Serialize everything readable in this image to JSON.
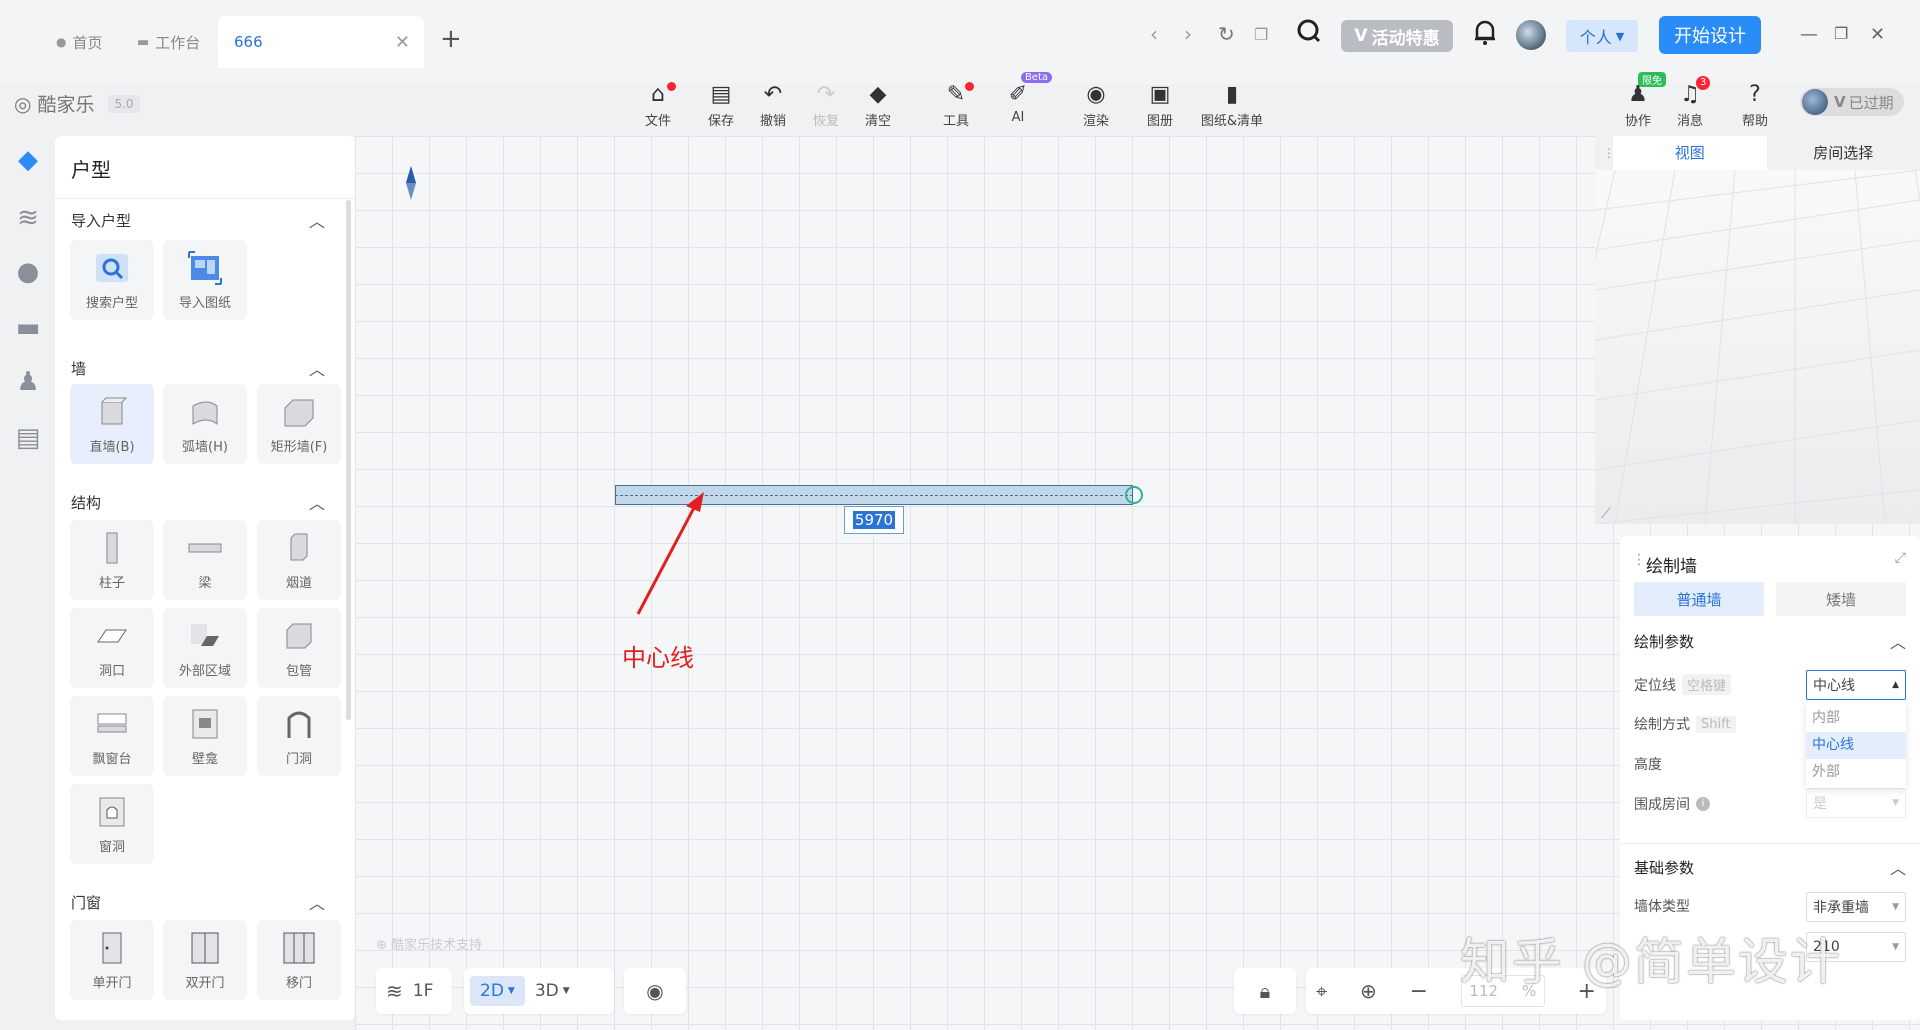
{
  "tabs": [
    {
      "label": "首页",
      "icon": "home-icon"
    },
    {
      "label": "工作台",
      "icon": "monitor-icon"
    },
    {
      "label": "666",
      "active": true
    }
  ],
  "topbar": {
    "promo_label": "活动特惠",
    "personal_label": "个人",
    "start_label": "开始设计"
  },
  "brand": {
    "name": "酷家乐",
    "version": "5.0"
  },
  "toolbar": {
    "file": "文件",
    "save": "保存",
    "undo": "撤销",
    "redo": "恢复",
    "clear": "清空",
    "tools": "工具",
    "ai": "AI",
    "ai_badge": "Beta",
    "render": "渲染",
    "album": "图册",
    "drawings": "图纸&清单"
  },
  "toolbar_right": {
    "collab": "协作",
    "collab_badge": "限免",
    "messages": "消息",
    "messages_badge": "3",
    "help": "帮助",
    "expired": "已过期"
  },
  "left_panel": {
    "title": "户型",
    "sections": {
      "import": {
        "title": "导入户型",
        "items": [
          "搜索户型",
          "导入图纸"
        ]
      },
      "wall": {
        "title": "墙",
        "items": [
          "直墙(B)",
          "弧墙(H)",
          "矩形墙(F)"
        ]
      },
      "structure": {
        "title": "结构",
        "items": [
          "柱子",
          "梁",
          "烟道",
          "洞口",
          "外部区域",
          "包管",
          "飘窗台",
          "壁龛",
          "门洞",
          "窗洞"
        ]
      },
      "doors": {
        "title": "门窗",
        "items": [
          "单开门",
          "双开门",
          "移门"
        ]
      }
    }
  },
  "canvas": {
    "dimension": "5970",
    "annotation": "中心线",
    "support_text": "酷家乐技术支持"
  },
  "bottom_bar": {
    "floor": "1F",
    "view_2d": "2D",
    "view_3d": "3D",
    "zoom": "112",
    "zoom_unit": "%"
  },
  "preview": {
    "tabs": [
      "视图",
      "房间选择"
    ]
  },
  "draw_wall": {
    "title": "绘制墙",
    "segments": [
      "普通墙",
      "矮墙"
    ],
    "params_title": "绘制参数",
    "position_label": "定位线",
    "position_key": "空格键",
    "position_value": "中心线",
    "position_options": [
      "内部",
      "中心线",
      "外部"
    ],
    "method_label": "绘制方式",
    "method_key": "Shift",
    "height_label": "高度",
    "room_label": "围成房间",
    "room_value": "是",
    "base_title": "基础参数",
    "wall_type_label": "墙体类型",
    "wall_type_value": "非承重墙",
    "thickness_value": "210"
  },
  "watermark": "知乎 @简单设计"
}
